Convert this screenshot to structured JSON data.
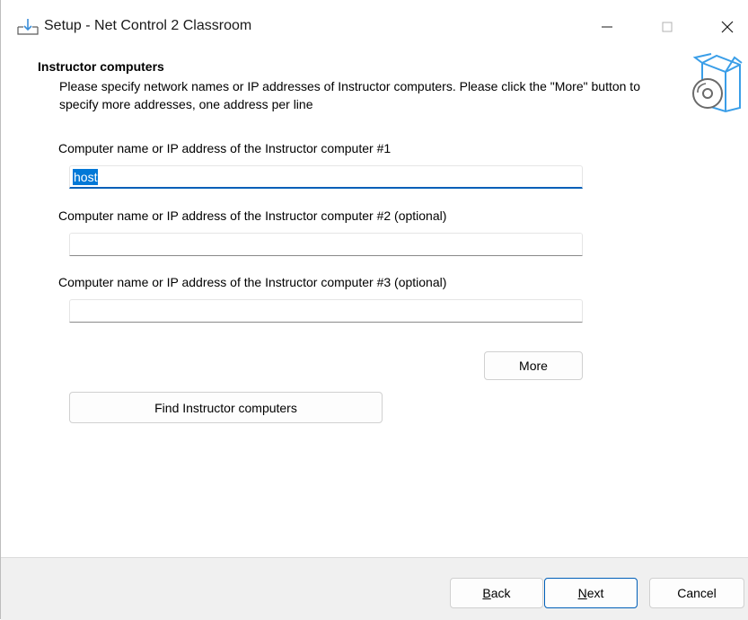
{
  "window": {
    "title": "Setup - Net Control 2 Classroom",
    "controls": {
      "minimize": "—",
      "maximize": "☐",
      "close": "✕"
    }
  },
  "header": {
    "title": "Instructor computers",
    "description": "Please specify network names or IP addresses of Instructor computers. Please click the \"More\" button to specify more addresses, one address per line"
  },
  "form": {
    "fields": [
      {
        "label": "Computer name or IP address of the Instructor computer #1",
        "value": "host"
      },
      {
        "label": "Computer name or IP address of the Instructor computer #2 (optional)",
        "value": ""
      },
      {
        "label": "Computer name or IP address of the Instructor computer #3 (optional)",
        "value": ""
      }
    ],
    "more_label": "More",
    "find_label": "Find Instructor computers"
  },
  "footer": {
    "back_mnemonic": "B",
    "back_rest": "ack",
    "next_mnemonic": "N",
    "next_rest": "ext",
    "cancel_label": "Cancel"
  },
  "colors": {
    "accent": "#005fb8",
    "selection": "#0078d7",
    "footer_bg": "#f0f0f0"
  }
}
